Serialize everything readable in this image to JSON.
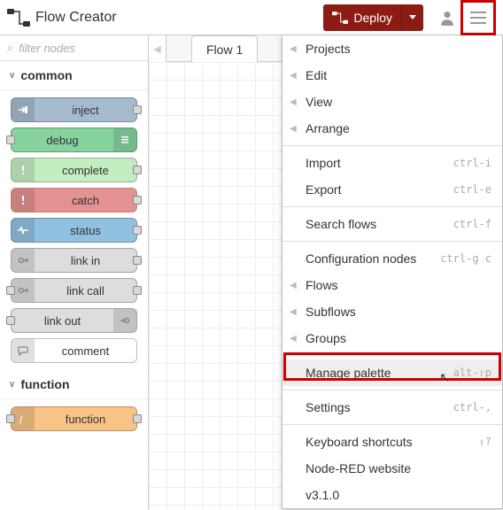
{
  "header": {
    "app_title": "Flow Creator",
    "deploy_label": "Deploy"
  },
  "sidebar": {
    "filter_placeholder": "filter nodes",
    "categories": [
      {
        "name": "common",
        "nodes": [
          {
            "label": "inject",
            "variant": "blue",
            "icon": "arrow-in",
            "icon_side": "left",
            "port_in": false,
            "port_out": true
          },
          {
            "label": "debug",
            "variant": "green",
            "icon": "bars",
            "icon_side": "right",
            "port_in": true,
            "port_out": false
          },
          {
            "label": "complete",
            "variant": "green2",
            "icon": "bang",
            "icon_side": "left",
            "port_in": false,
            "port_out": true
          },
          {
            "label": "catch",
            "variant": "red",
            "icon": "bang",
            "icon_side": "left",
            "port_in": false,
            "port_out": true
          },
          {
            "label": "status",
            "variant": "blue2",
            "icon": "pulse",
            "icon_side": "left",
            "port_in": false,
            "port_out": true
          },
          {
            "label": "link in",
            "variant": "grey",
            "icon": "link-in",
            "icon_side": "left",
            "port_in": false,
            "port_out": true
          },
          {
            "label": "link call",
            "variant": "grey",
            "icon": "link-in",
            "icon_side": "left",
            "port_in": true,
            "port_out": true
          },
          {
            "label": "link out",
            "variant": "grey",
            "icon": "link-out",
            "icon_side": "right",
            "port_in": true,
            "port_out": false
          },
          {
            "label": "comment",
            "variant": "white",
            "icon": "comment",
            "icon_side": "left",
            "port_in": false,
            "port_out": false
          }
        ]
      },
      {
        "name": "function",
        "nodes": [
          {
            "label": "function",
            "variant": "orange",
            "icon": "fx",
            "icon_side": "left",
            "port_in": true,
            "port_out": true
          }
        ]
      }
    ]
  },
  "workspace": {
    "tab_label": "Flow 1"
  },
  "menu": {
    "groups": [
      [
        {
          "label": "Projects",
          "submenu": true
        },
        {
          "label": "Edit",
          "submenu": true
        },
        {
          "label": "View",
          "submenu": true
        },
        {
          "label": "Arrange",
          "submenu": true
        }
      ],
      [
        {
          "label": "Import",
          "shortcut": "ctrl-i"
        },
        {
          "label": "Export",
          "shortcut": "ctrl-e"
        }
      ],
      [
        {
          "label": "Search flows",
          "shortcut": "ctrl-f"
        }
      ],
      [
        {
          "label": "Configuration nodes",
          "shortcut": "ctrl-g c"
        },
        {
          "label": "Flows",
          "submenu": true
        },
        {
          "label": "Subflows",
          "submenu": true
        },
        {
          "label": "Groups",
          "submenu": true
        }
      ],
      [
        {
          "label": "Manage palette",
          "shortcut": "alt-⇧p",
          "active": true
        }
      ],
      [
        {
          "label": "Settings",
          "shortcut": "ctrl-,"
        }
      ],
      [
        {
          "label": "Keyboard shortcuts",
          "shortcut": "⇧?"
        },
        {
          "label": "Node-RED website"
        },
        {
          "label": "v3.1.0"
        }
      ]
    ]
  }
}
